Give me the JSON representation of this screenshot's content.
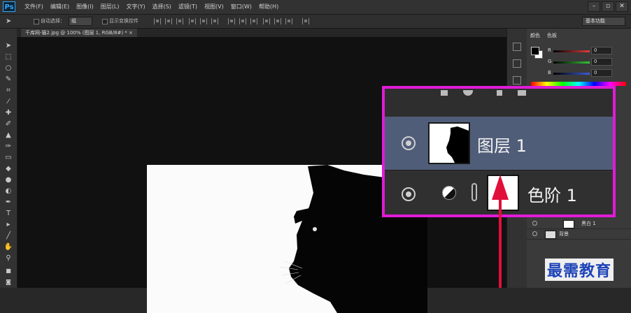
{
  "app": {
    "logo": "Ps"
  },
  "menu": [
    "文件(F)",
    "编辑(E)",
    "图像(I)",
    "图层(L)",
    "文字(Y)",
    "选择(S)",
    "滤镜(T)",
    "视图(V)",
    "窗口(W)",
    "帮助(H)"
  ],
  "options_bar": {
    "auto_select_label": "自动选择：",
    "auto_select_value": "组",
    "show_transform_label": "显示变换控件",
    "workspace": "基本功能"
  },
  "document_tab": "千库网-猫2.jpg @ 100% (图层 1, RGB/8#) * ×",
  "color_panel": {
    "tabs": [
      "颜色",
      "色板"
    ],
    "channels": [
      {
        "label": "R",
        "value": "0",
        "color": "#e33b3b"
      },
      {
        "label": "G",
        "value": "0",
        "color": "#34c534"
      },
      {
        "label": "B",
        "value": "0",
        "color": "#3a5de0"
      }
    ]
  },
  "layers_panel": {
    "rows": [
      {
        "name": "黑白 1",
        "type": "adjustment"
      },
      {
        "name": "背景",
        "type": "image"
      }
    ]
  },
  "zoom_callout": {
    "layer1_name": "图层 1",
    "levels_name": "色阶 1",
    "border_color": "#e01bd8",
    "selected_row_color": "#505d79"
  },
  "watermark": "最需教育"
}
